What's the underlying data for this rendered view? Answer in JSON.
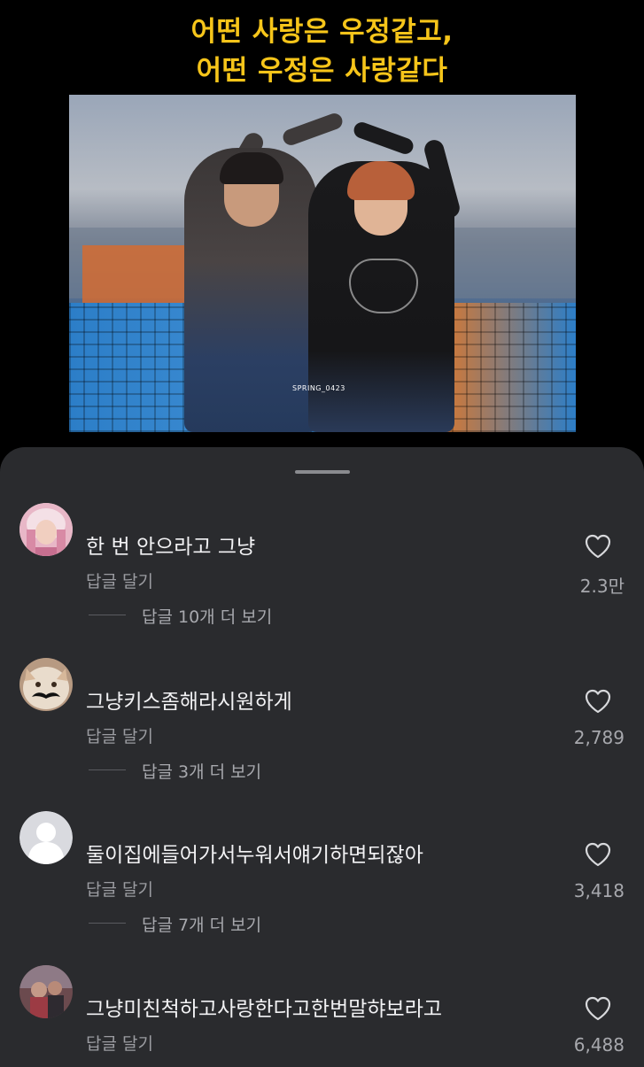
{
  "video": {
    "caption_line1": "어떤 사랑은 우정같고,",
    "caption_line2": "어떤 우정은 사랑같다",
    "watermark": "SPRING_0423"
  },
  "comments": [
    {
      "text": "한 번 안으라고 그냥",
      "reply_label": "답글 달기",
      "likes": "2.3만",
      "more_replies": "답글 10개 더 보기",
      "avatar_style": "pink-hair"
    },
    {
      "text": "그냥키스좀해라시원하게",
      "reply_label": "답글 달기",
      "likes": "2,789",
      "more_replies": "답글 3개 더 보기",
      "avatar_style": "cat-mustache"
    },
    {
      "text": "둘이집에들어가서누워서얘기하면되잖아",
      "reply_label": "답글 달기",
      "likes": "3,418",
      "more_replies": "답글 7개 더 보기",
      "avatar_style": "default-user"
    },
    {
      "text": "그냥미친척하고사랑한다고한번말햐보라고",
      "reply_label": "답글 달기",
      "likes": "6,488",
      "avatar_style": "photo"
    }
  ],
  "colors": {
    "caption": "#f6c51a",
    "sheet_bg": "#2a2b2e",
    "text": "#f2f2f4",
    "muted": "#9b9ca1"
  },
  "icons": {
    "like": "heart-outline-icon",
    "user": "default-avatar-icon"
  }
}
